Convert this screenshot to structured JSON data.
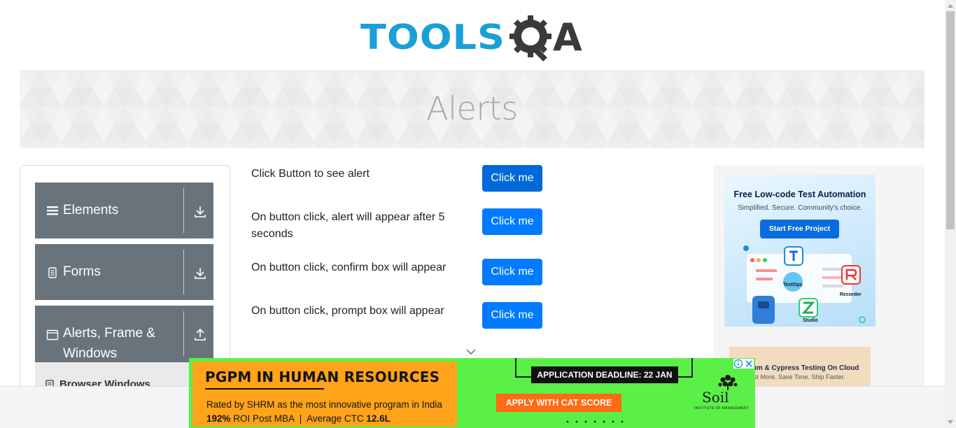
{
  "header": {
    "logo_text": "TOOLS",
    "logo_suffix": "A",
    "logo_alt": "TOOLSQA",
    "page_title": "Alerts"
  },
  "sidebar": {
    "groups": [
      {
        "label": "Elements",
        "icon": "menu-lines-icon",
        "arrow": "download-arrow-icon"
      },
      {
        "label": "Forms",
        "icon": "document-icon",
        "arrow": "download-arrow-icon"
      },
      {
        "label": "Alerts, Frame & Windows",
        "label_line1": "Alerts, Frame &",
        "label_line2": "Windows",
        "icon": "window-icon",
        "arrow": "upload-arrow-icon"
      }
    ],
    "sub_items": [
      {
        "label": "Browser Windows",
        "icon": "list-icon"
      }
    ]
  },
  "main": {
    "rows": [
      {
        "label": "Click Button to see alert",
        "button": "Click me"
      },
      {
        "label": "On button click, alert will appear after 5 seconds",
        "label_line1": "On button click, alert will appear after 5",
        "label_line2": "seconds",
        "button": "Click me"
      },
      {
        "label": "On button click, confirm box will appear",
        "button": "Click me"
      },
      {
        "label": "On button click, prompt box will appear",
        "button": "Click me"
      }
    ]
  },
  "right_ad": {
    "title": "Free Low-code Test Automation",
    "subtitle": "Simplified. Secure. Community's choice.",
    "button": "Start Free Project",
    "labels": [
      "TestOps",
      "Recorder",
      "Studio"
    ],
    "ad2_title": "ium & Cypress Testing On Cloud",
    "ad2_sub": "est More. Save Time. Ship Faster."
  },
  "bottom_ad": {
    "title": "PGPM IN HUMAN RESOURCES",
    "line1": "Rated by SHRM as the most innovative program in India",
    "line2_pct": "192%",
    "line2_mid": " ROI Post MBA  |  Average CTC ",
    "line2_ctc": "12.6L",
    "deadline": "APPLICATION DEADLINE: 22 JAN",
    "cta": "APPLY WITH CAT SCORE",
    "brand": "Soil",
    "brand_sub": "INSTITUTE OF MANAGEMENT"
  },
  "colors": {
    "primary_button": "#007bff",
    "sidebar_group": "#69737b",
    "logo_blue": "#1a9fd8",
    "ad_green": "#5af048",
    "ad_orange": "#ffa31a"
  }
}
